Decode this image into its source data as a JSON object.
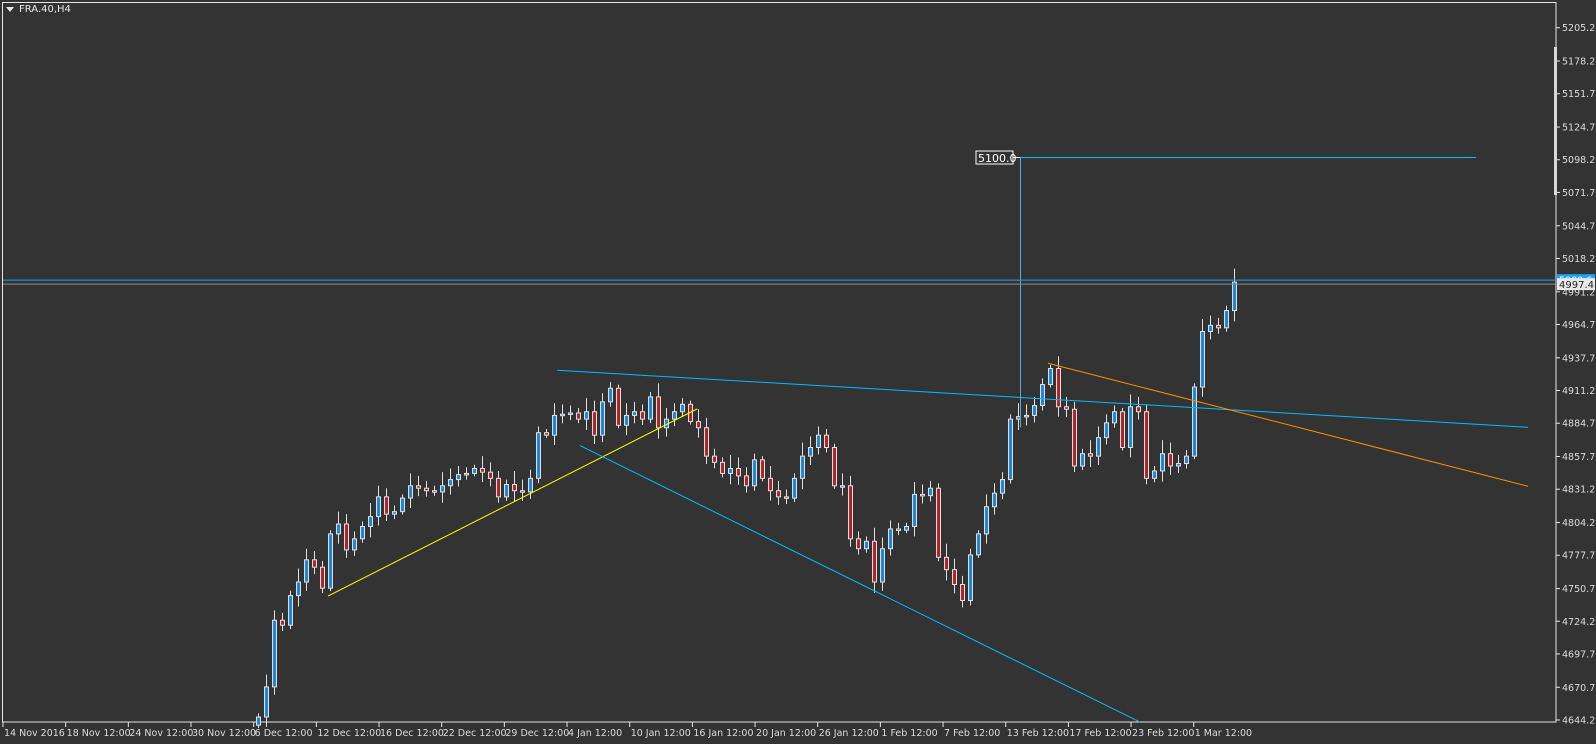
{
  "window": {
    "symbol_title": "FRA.40,H4"
  },
  "colors": {
    "background": "#333333",
    "axis": "#e6e6e6",
    "bull_body": "#1e88d8",
    "bear_body": "#b22428",
    "candle_outline": "#e0e0e0",
    "ask_line": "#1aa3ff",
    "bid_line": "#8a8a8a",
    "yellow_trend": "#ffff00",
    "cyan_trend": "#00bfff",
    "orange_trend": "#ff8c00"
  },
  "chart_data": {
    "type": "candlestick",
    "title": "FRA.40,H4",
    "ylim": [
      4644.2,
      5205.2
    ],
    "grid": false,
    "y_ticks": [
      "5205.2",
      "5178.2",
      "5151.7",
      "5124.7",
      "5098.2",
      "5071.7",
      "5044.7",
      "5018.2",
      "4991.2",
      "4964.7",
      "4937.7",
      "4911.2",
      "4884.7",
      "4857.7",
      "4831.2",
      "4804.2",
      "4777.7",
      "4750.7",
      "4724.2",
      "4697.7",
      "4670.7",
      "4644.2"
    ],
    "x_labels": [
      "14 Nov 2016",
      "18 Nov 12:00",
      "24 Nov 12:00",
      "30 Nov 12:00",
      "6 Dec 12:00",
      "12 Dec 12:00",
      "16 Dec 12:00",
      "22 Dec 12:00",
      "29 Dec 12:00",
      "4 Jan 12:00",
      "10 Jan 12:00",
      "16 Jan 12:00",
      "20 Jan 12:00",
      "26 Jan 12:00",
      "1 Feb 12:00",
      "7 Feb 12:00",
      "13 Feb 12:00",
      "17 Feb 12:00",
      "23 Feb 12:00",
      "1 Mar 12:00"
    ],
    "first_open": 4640,
    "closes": [
      4646.6,
      4671,
      4725,
      4721,
      4745,
      4756,
      4774,
      4768,
      4751,
      4795,
      4803,
      4782,
      4791,
      4801,
      4809,
      4825,
      4811,
      4813,
      4824,
      4834,
      4832,
      4830,
      4829,
      4834,
      4839,
      4843,
      4844,
      4848,
      4845,
      4840,
      4825,
      4835,
      4830,
      4829,
      4840,
      4877,
      4875,
      4891,
      4892,
      4893,
      4888,
      4894,
      4875,
      4902,
      4913,
      4883,
      4891,
      4894,
      4888,
      4906,
      4881,
      4888,
      4894,
      4900,
      4886,
      4881,
      4858,
      4853,
      4844,
      4848,
      4842,
      4834,
      4855,
      4840,
      4830,
      4825,
      4824,
      4840,
      4858,
      4865,
      4875,
      4865,
      4834,
      4834,
      4791,
      4783,
      4789,
      4756,
      4783,
      4799,
      4798,
      4801,
      4827,
      4826,
      4832,
      4776,
      4766,
      4754,
      4741,
      4778,
      4795,
      4817,
      4828,
      4839,
      4888,
      4890,
      4891,
      4899,
      4916,
      4929,
      4898,
      4896,
      4850,
      4860,
      4858,
      4873,
      4885,
      4894,
      4865,
      4898,
      4894,
      4840,
      4846,
      4860,
      4850,
      4852,
      4858,
      4914,
      4959,
      4964,
      4962,
      4976,
      4999
    ],
    "trendlines": [
      {
        "name": "yellow-support",
        "color_key": "yellow_trend",
        "from": [
          8.75,
          4744.6
        ],
        "to": [
          54.9,
          4896.3
        ]
      },
      {
        "name": "cyan-channel-top",
        "color_key": "cyan_trend",
        "from": [
          37.4,
          4927.6
        ],
        "to": [
          158.75,
          4881.4
        ]
      },
      {
        "name": "cyan-channel-bottom",
        "color_key": "cyan_trend",
        "from": [
          40.25,
          4866.6
        ],
        "to": [
          110.25,
          4642.5
        ]
      },
      {
        "name": "orange-resistance",
        "color_key": "orange_trend",
        "from": [
          98.75,
          4933.3
        ],
        "to": [
          158.75,
          4833.6
        ]
      }
    ],
    "target_level": {
      "label": "5100.0",
      "price": 5100.0,
      "from_index": 95.25,
      "to_index": 152.25,
      "stem_bottom_price": 4881.4
    },
    "bid": {
      "label": "4997.4",
      "price": 4997.4
    },
    "ask": {
      "label": "5000.6",
      "price": 5000.6
    }
  }
}
